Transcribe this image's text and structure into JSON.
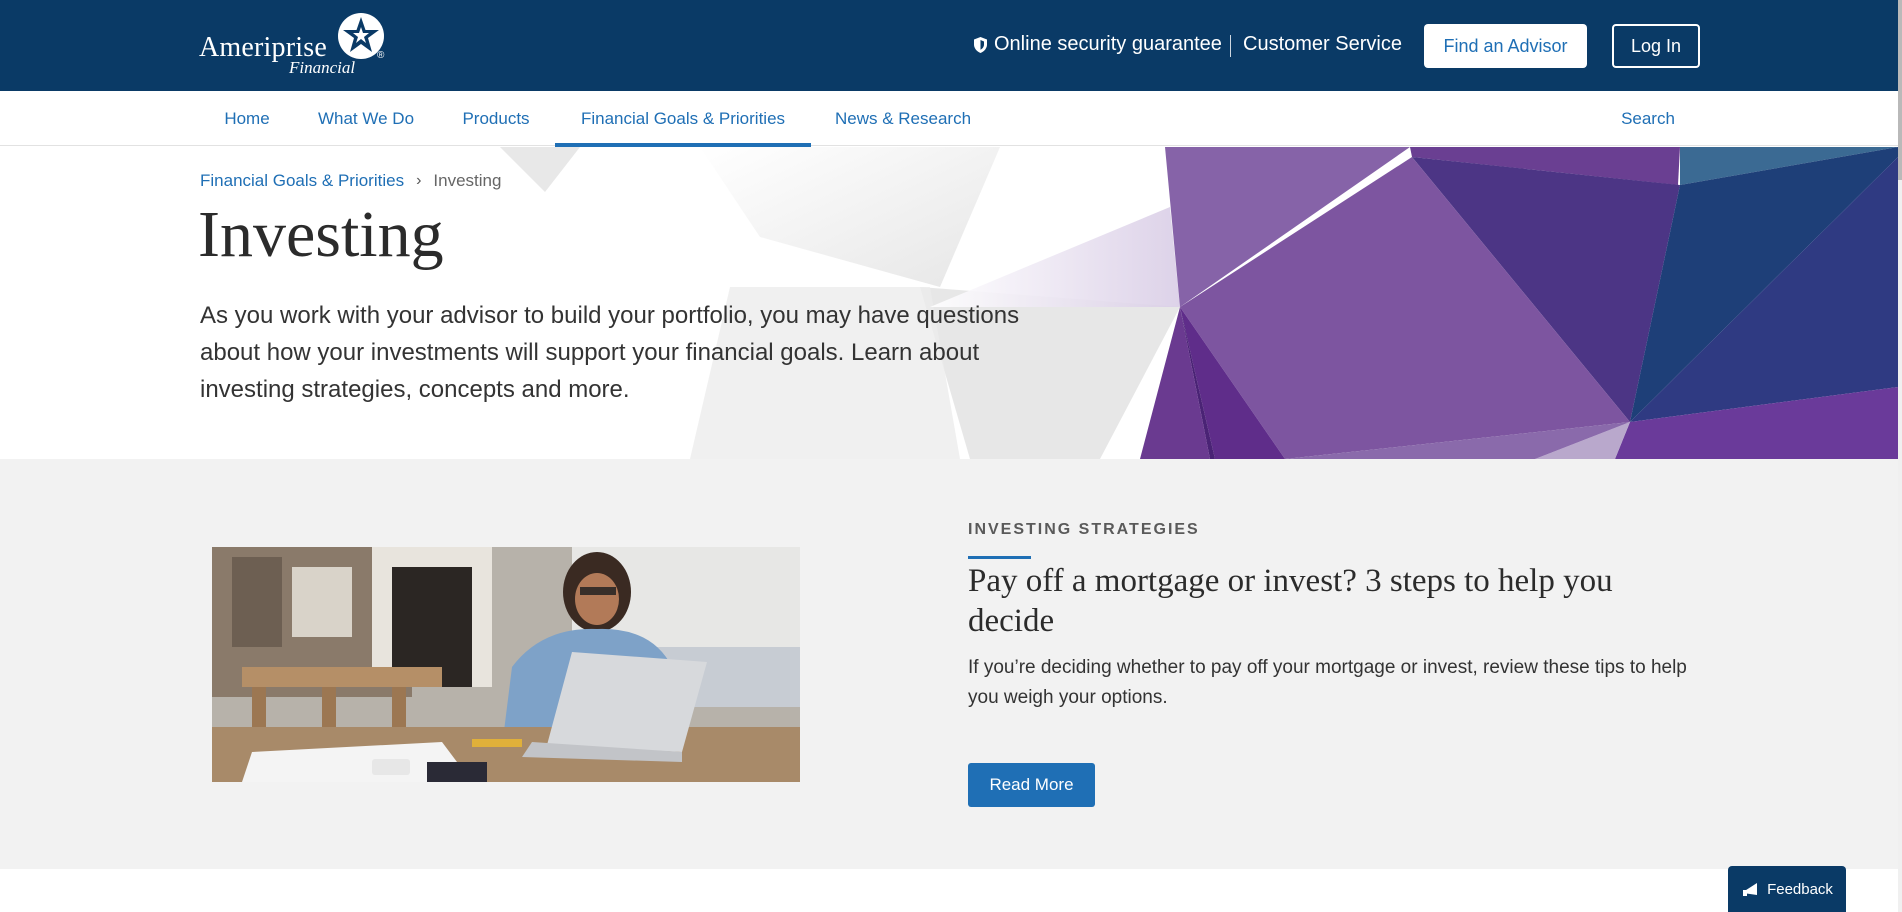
{
  "header": {
    "logo": {
      "name": "Ameriprise",
      "sub": "Financial",
      "reg": "®"
    },
    "security_label": "Online security guarantee",
    "security_icon": "shield-icon",
    "customer_service_label": "Customer Service",
    "find_advisor_label": "Find an Advisor",
    "login_label": "Log In"
  },
  "nav": {
    "items": [
      {
        "label": "Home"
      },
      {
        "label": "What We Do"
      },
      {
        "label": "Products"
      },
      {
        "label": "Financial Goals & Priorities",
        "active": true
      },
      {
        "label": "News & Research"
      }
    ],
    "search_label": "Search"
  },
  "hero": {
    "breadcrumb": {
      "parent": "Financial Goals & Priorities",
      "separator": "›",
      "current": "Investing"
    },
    "title": "Investing",
    "description": "As you work with your advisor to build your portfolio, you may have questions about how your investments will support your financial goals. Learn about investing strategies, concepts and more."
  },
  "feature": {
    "eyebrow": "INVESTING STRATEGIES",
    "title": "Pay off a mortgage or invest? 3 steps to help you decide",
    "body": "If you’re deciding whether to pay off your mortgage or invest, review these tips to help you weigh your options.",
    "cta_label": "Read More"
  },
  "feedback": {
    "label": "Feedback",
    "icon": "megaphone-icon"
  },
  "colors": {
    "header_bg": "#0a3a66",
    "link_blue": "#1f6fb5",
    "section_bg": "#f2f2f2",
    "purple_dark": "#5a2a82",
    "purple_mid": "#7a4f9e"
  }
}
